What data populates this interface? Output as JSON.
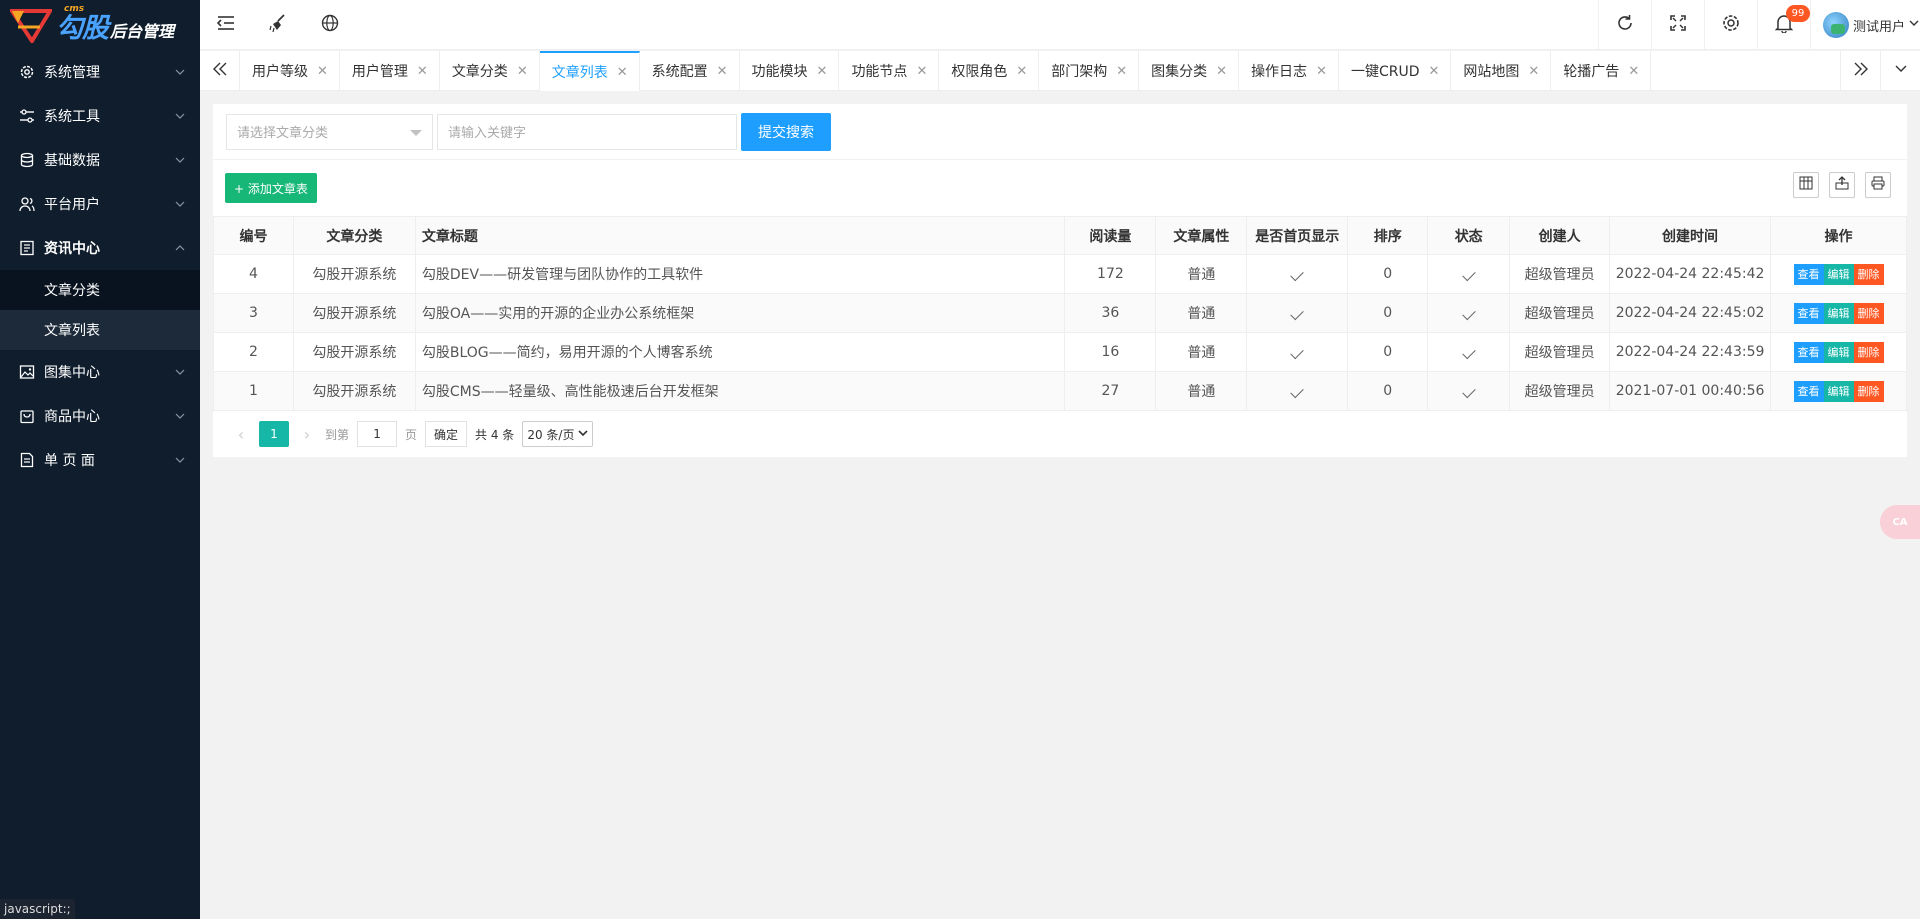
{
  "app": {
    "logo_small": "cms",
    "logo_brand": "勾股",
    "logo_sub": "后台管理"
  },
  "sidebar": {
    "items": [
      {
        "label": "系统管理",
        "icon": "gear-icon"
      },
      {
        "label": "系统工具",
        "icon": "sliders-icon"
      },
      {
        "label": "基础数据",
        "icon": "database-icon"
      },
      {
        "label": "平台用户",
        "icon": "users-icon"
      },
      {
        "label": "资讯中心",
        "icon": "article-icon"
      },
      {
        "label": "图集中心",
        "icon": "image-icon"
      },
      {
        "label": "商品中心",
        "icon": "bag-icon"
      },
      {
        "label": "单 页 面",
        "icon": "page-icon"
      }
    ],
    "sub_items": [
      {
        "label": "文章分类"
      },
      {
        "label": "文章列表"
      }
    ]
  },
  "header": {
    "notification_count": "99",
    "user_name": "测试用户"
  },
  "tabs": [
    {
      "label": "用户等级"
    },
    {
      "label": "用户管理"
    },
    {
      "label": "文章分类"
    },
    {
      "label": "文章列表"
    },
    {
      "label": "系统配置"
    },
    {
      "label": "功能模块"
    },
    {
      "label": "功能节点"
    },
    {
      "label": "权限角色"
    },
    {
      "label": "部门架构"
    },
    {
      "label": "图集分类"
    },
    {
      "label": "操作日志"
    },
    {
      "label": "一键CRUD"
    },
    {
      "label": "网站地图"
    },
    {
      "label": "轮播广告"
    }
  ],
  "filter": {
    "category_placeholder": "请选择文章分类",
    "keyword_placeholder": "请输入关键字",
    "submit_label": "提交搜索"
  },
  "toolbar": {
    "add_label": "+ 添加文章表"
  },
  "table": {
    "headers": [
      "编号",
      "文章分类",
      "文章标题",
      "阅读量",
      "文章属性",
      "是否首页显示",
      "排序",
      "状态",
      "创建人",
      "创建时间",
      "操作"
    ],
    "rows": [
      {
        "id": "4",
        "category": "勾股开源系统",
        "title": "勾股DEV——研发管理与团队协作的工具软件",
        "reads": "172",
        "attr": "普通",
        "sort": "0",
        "creator": "超级管理员",
        "created": "2022-04-24 22:45:42"
      },
      {
        "id": "3",
        "category": "勾股开源系统",
        "title": "勾股OA——实用的开源的企业办公系统框架",
        "reads": "36",
        "attr": "普通",
        "sort": "0",
        "creator": "超级管理员",
        "created": "2022-04-24 22:45:02"
      },
      {
        "id": "2",
        "category": "勾股开源系统",
        "title": "勾股BLOG——简约，易用开源的个人博客系统",
        "reads": "16",
        "attr": "普通",
        "sort": "0",
        "creator": "超级管理员",
        "created": "2022-04-24 22:43:59"
      },
      {
        "id": "1",
        "category": "勾股开源系统",
        "title": "勾股CMS——轻量级、高性能极速后台开发框架",
        "reads": "27",
        "attr": "普通",
        "sort": "0",
        "creator": "超级管理员",
        "created": "2021-07-01 00:40:56"
      }
    ],
    "ops": {
      "view": "查看",
      "edit": "编辑",
      "delete": "删除"
    }
  },
  "pager": {
    "current": "1",
    "goto_label": "到第",
    "goto_value": "1",
    "page_label": "页",
    "confirm_label": "确定",
    "total_label": "共 4 条",
    "page_size": "20 条/页"
  },
  "status_bar": "javascript:;",
  "float_button": "CA"
}
